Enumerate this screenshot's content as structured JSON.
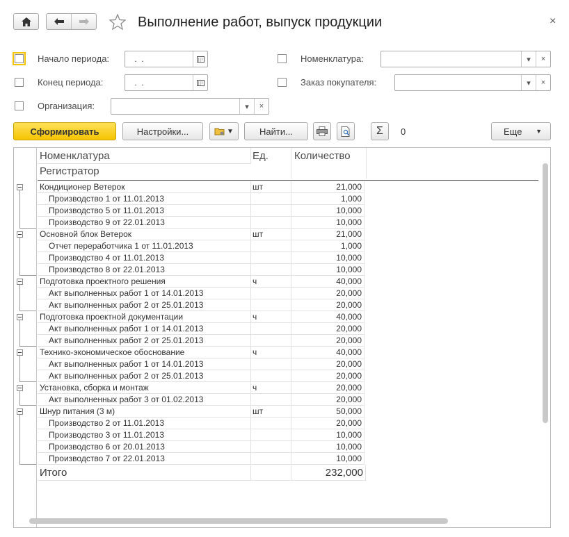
{
  "window": {
    "title": "Выполнение работ, выпуск продукции",
    "close_glyph": "×"
  },
  "filters": {
    "period_start": {
      "label": "Начало периода:",
      "value": " .  ."
    },
    "period_end": {
      "label": "Конец периода:",
      "value": " .  ."
    },
    "organization": {
      "label": "Организация:",
      "value": ""
    },
    "nomenclature": {
      "label": "Номенклатура:",
      "value": ""
    },
    "customer_order": {
      "label": "Заказ покупателя:",
      "value": ""
    }
  },
  "toolbar": {
    "generate_label": "Сформировать",
    "settings_label": "Настройки...",
    "find_label": "Найти...",
    "sum_value": "0",
    "more_label": "Еще"
  },
  "report": {
    "headers": {
      "col1": "Номенклатура",
      "col1_sub": "Регистратор",
      "col2": "Ед.",
      "col3": "Количество"
    },
    "groups": [
      {
        "name": "Кондиционер Ветерок",
        "unit": "шт",
        "qty": "21,000",
        "rows": [
          {
            "name": "Производство 1 от 11.01.2013",
            "qty": "1,000"
          },
          {
            "name": "Производство 5 от 11.01.2013",
            "qty": "10,000"
          },
          {
            "name": "Производство 9 от 22.01.2013",
            "qty": "10,000"
          }
        ]
      },
      {
        "name": "Основной блок Ветерок",
        "unit": "шт",
        "qty": "21,000",
        "rows": [
          {
            "name": "Отчет переработчика 1 от 11.01.2013",
            "qty": "1,000"
          },
          {
            "name": "Производство 4 от 11.01.2013",
            "qty": "10,000"
          },
          {
            "name": "Производство 8 от 22.01.2013",
            "qty": "10,000"
          }
        ]
      },
      {
        "name": "Подготовка проектного решения",
        "unit": "ч",
        "qty": "40,000",
        "rows": [
          {
            "name": "Акт выполненных работ 1 от 14.01.2013",
            "qty": "20,000"
          },
          {
            "name": "Акт выполненных работ 2 от 25.01.2013",
            "qty": "20,000"
          }
        ]
      },
      {
        "name": "Подготовка проектной документации",
        "unit": "ч",
        "qty": "40,000",
        "rows": [
          {
            "name": "Акт выполненных работ 1 от 14.01.2013",
            "qty": "20,000"
          },
          {
            "name": "Акт выполненных работ 2 от 25.01.2013",
            "qty": "20,000"
          }
        ]
      },
      {
        "name": "Технико-экономическое обоснование",
        "unit": "ч",
        "qty": "40,000",
        "rows": [
          {
            "name": "Акт выполненных работ 1 от 14.01.2013",
            "qty": "20,000"
          },
          {
            "name": "Акт выполненных работ 2 от 25.01.2013",
            "qty": "20,000"
          }
        ]
      },
      {
        "name": "Установка, сборка и монтаж",
        "unit": "ч",
        "qty": "20,000",
        "rows": [
          {
            "name": "Акт выполненных работ 3 от 01.02.2013",
            "qty": "20,000"
          }
        ]
      },
      {
        "name": "Шнур питания (3 м)",
        "unit": "шт",
        "qty": "50,000",
        "rows": [
          {
            "name": "Производство 2 от 11.01.2013",
            "qty": "20,000"
          },
          {
            "name": "Производство 3 от 11.01.2013",
            "qty": "10,000"
          },
          {
            "name": "Производство 6 от 20.01.2013",
            "qty": "10,000"
          },
          {
            "name": "Производство 7 от 22.01.2013",
            "qty": "10,000"
          }
        ]
      }
    ],
    "total": {
      "label": "Итого",
      "qty": "232,000"
    }
  },
  "icons": [
    "home-icon",
    "back-arrow-icon",
    "forward-arrow-icon",
    "star-icon",
    "calendar-icon",
    "dropdown-arrow-icon",
    "clear-icon",
    "folder-settings-icon",
    "print-icon",
    "preview-icon",
    "sigma-icon",
    "collapse-icon"
  ],
  "colors": {
    "primary_button": "#f5c400",
    "border": "#a9a9a9",
    "grid_line": "#e2e2e2"
  }
}
